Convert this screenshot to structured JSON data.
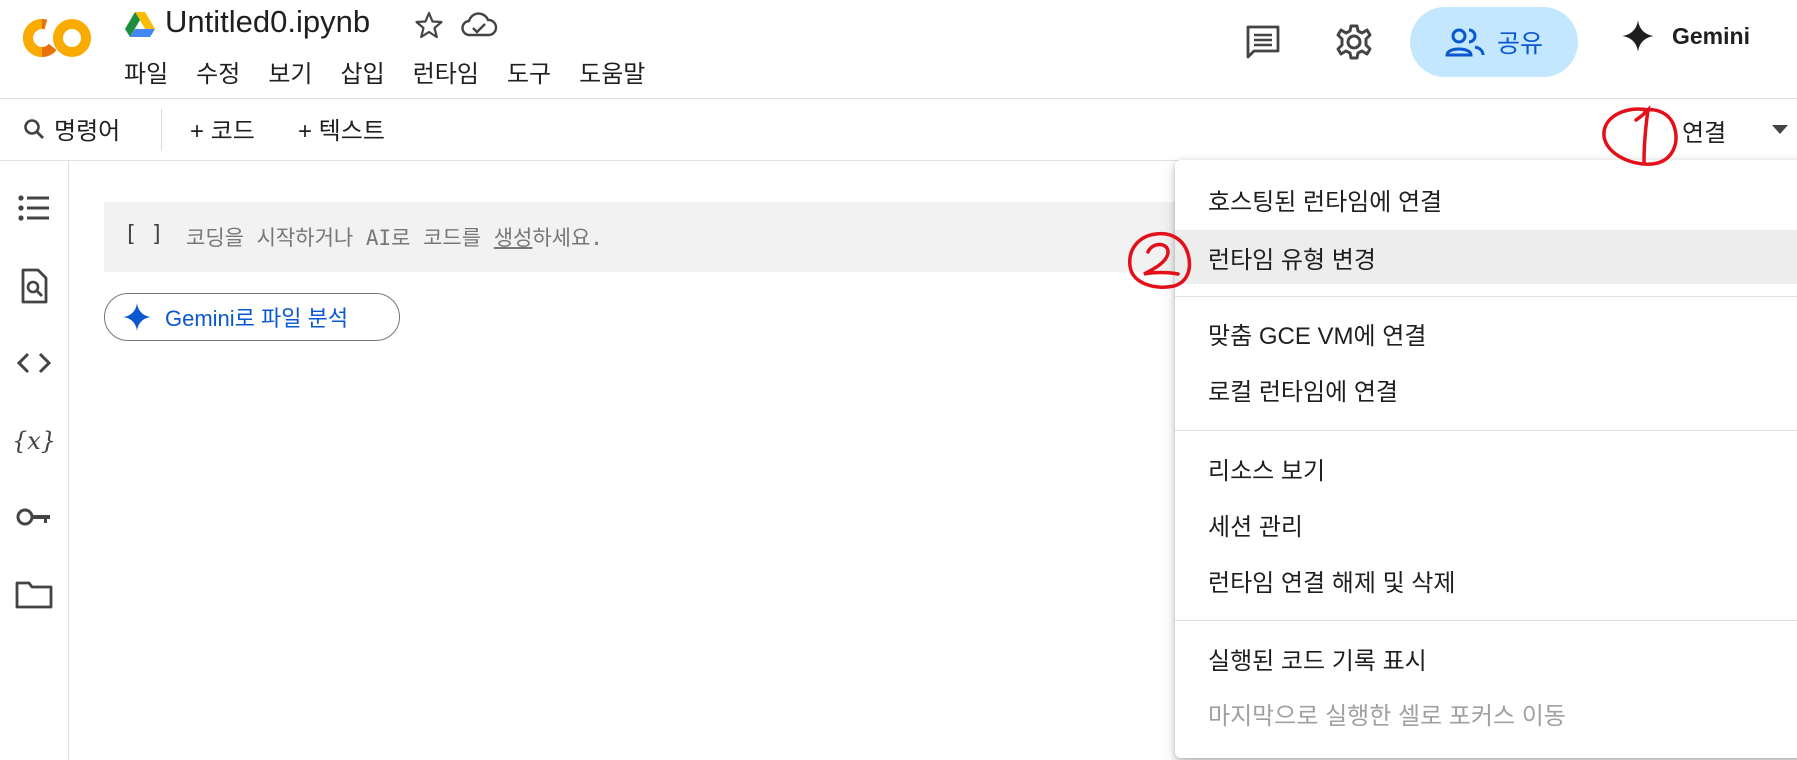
{
  "header": {
    "title": "Untitled0.ipynb",
    "menu": [
      "파일",
      "수정",
      "보기",
      "삽입",
      "런타임",
      "도구",
      "도움말"
    ],
    "share_label": "공유",
    "gemini_label": "Gemini"
  },
  "toolbar": {
    "command_label": "명령어",
    "add_code_label": "+ 코드",
    "add_text_label": "+ 텍스트",
    "connect_label": "연결"
  },
  "sidebar": {
    "icons": [
      "table-of-contents-icon",
      "find-replace-icon",
      "code-snippets-icon",
      "variables-icon",
      "secrets-key-icon",
      "files-folder-icon"
    ]
  },
  "cell": {
    "bracket": "[ ]",
    "placeholder_prefix": "코딩을 시작하거나 AI로 코드를 ",
    "placeholder_link": "생성",
    "placeholder_suffix": "하세요."
  },
  "gemini_analyze_label": "Gemini로 파일 분석",
  "dropdown": {
    "items": [
      "호스팅된 런타임에 연결",
      "런타임 유형 변경",
      "맞춤 GCE VM에 연결",
      "로컬 런타임에 연결",
      "리소스 보기",
      "세션 관리",
      "런타임 연결 해제 및 삭제",
      "실행된 코드 기록 표시",
      "마지막으로 실행한 셀로 포커스 이동"
    ],
    "hovered_item": "런타임 유형 변경",
    "disabled_item": "마지막으로 실행한 셀로 포커스 이동"
  },
  "colors": {
    "accent_blue": "#0b57d0",
    "share_bg": "#c2e7ff",
    "logo_orange": "#f9ab00",
    "logo_dark_orange": "#e8710a",
    "annotation_red": "#e3101a"
  }
}
